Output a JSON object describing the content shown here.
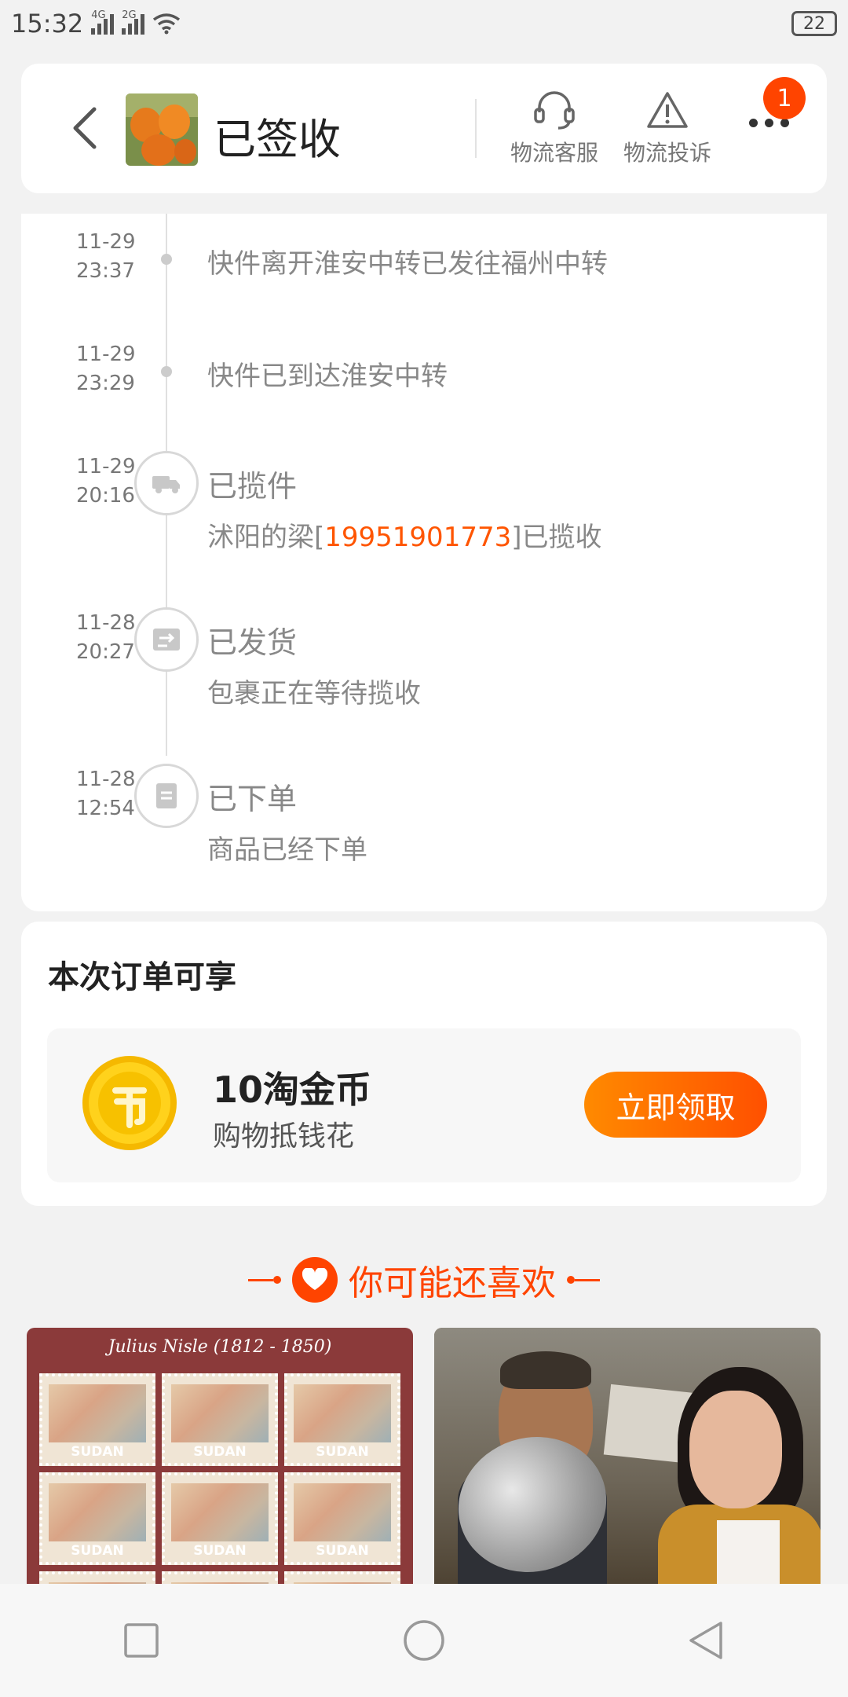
{
  "status_bar": {
    "time": "15:32",
    "signal1_tag": "4G",
    "signal2_tag": "2G",
    "battery": "22"
  },
  "header": {
    "title": "已签收",
    "service_label": "物流客服",
    "complaint_label": "物流投诉",
    "badge": "1"
  },
  "timeline": [
    {
      "date": "11-29",
      "time": "23:37",
      "text": "快件离开淮安中转已发往福州中转"
    },
    {
      "date": "11-29",
      "time": "23:29",
      "text": "快件已到达淮安中转"
    },
    {
      "date": "11-29",
      "time": "20:16",
      "title": "已揽件",
      "desc_prefix": "沭阳的梁[",
      "phone": "19951901773",
      "desc_suffix": "]已揽收",
      "icon": "truck-icon"
    },
    {
      "date": "11-28",
      "time": "20:27",
      "title": "已发货",
      "desc": "包裹正在等待揽收",
      "icon": "shipped-icon"
    },
    {
      "date": "11-28",
      "time": "12:54",
      "title": "已下单",
      "desc": "商品已经下单",
      "icon": "order-icon"
    }
  ],
  "reward": {
    "heading": "本次订单可享",
    "amount": "10淘金币",
    "subtitle": "购物抵钱花",
    "button": "立即领取"
  },
  "recommend": {
    "heading": "你可能还喜欢",
    "stamp_title": "Julius Nisle (1812 - 1850)",
    "stamp_country": "SUDAN"
  },
  "colors": {
    "accent": "#ff5000",
    "badge": "#ff4400"
  }
}
